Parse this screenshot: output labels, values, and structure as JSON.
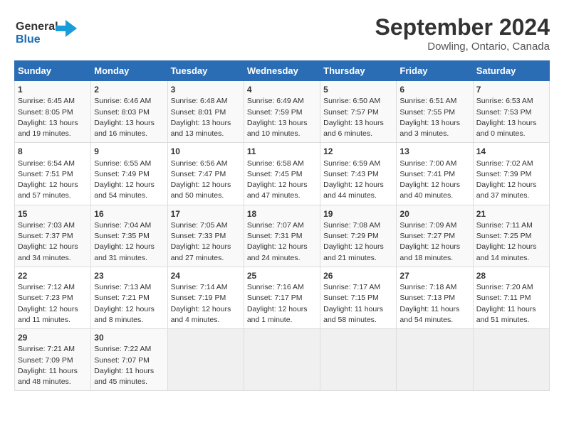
{
  "header": {
    "logo_line1": "General",
    "logo_line2": "Blue",
    "month": "September 2024",
    "location": "Dowling, Ontario, Canada"
  },
  "days_of_week": [
    "Sunday",
    "Monday",
    "Tuesday",
    "Wednesday",
    "Thursday",
    "Friday",
    "Saturday"
  ],
  "weeks": [
    [
      {
        "day": "1",
        "info": "Sunrise: 6:45 AM\nSunset: 8:05 PM\nDaylight: 13 hours\nand 19 minutes."
      },
      {
        "day": "2",
        "info": "Sunrise: 6:46 AM\nSunset: 8:03 PM\nDaylight: 13 hours\nand 16 minutes."
      },
      {
        "day": "3",
        "info": "Sunrise: 6:48 AM\nSunset: 8:01 PM\nDaylight: 13 hours\nand 13 minutes."
      },
      {
        "day": "4",
        "info": "Sunrise: 6:49 AM\nSunset: 7:59 PM\nDaylight: 13 hours\nand 10 minutes."
      },
      {
        "day": "5",
        "info": "Sunrise: 6:50 AM\nSunset: 7:57 PM\nDaylight: 13 hours\nand 6 minutes."
      },
      {
        "day": "6",
        "info": "Sunrise: 6:51 AM\nSunset: 7:55 PM\nDaylight: 13 hours\nand 3 minutes."
      },
      {
        "day": "7",
        "info": "Sunrise: 6:53 AM\nSunset: 7:53 PM\nDaylight: 13 hours\nand 0 minutes."
      }
    ],
    [
      {
        "day": "8",
        "info": "Sunrise: 6:54 AM\nSunset: 7:51 PM\nDaylight: 12 hours\nand 57 minutes."
      },
      {
        "day": "9",
        "info": "Sunrise: 6:55 AM\nSunset: 7:49 PM\nDaylight: 12 hours\nand 54 minutes."
      },
      {
        "day": "10",
        "info": "Sunrise: 6:56 AM\nSunset: 7:47 PM\nDaylight: 12 hours\nand 50 minutes."
      },
      {
        "day": "11",
        "info": "Sunrise: 6:58 AM\nSunset: 7:45 PM\nDaylight: 12 hours\nand 47 minutes."
      },
      {
        "day": "12",
        "info": "Sunrise: 6:59 AM\nSunset: 7:43 PM\nDaylight: 12 hours\nand 44 minutes."
      },
      {
        "day": "13",
        "info": "Sunrise: 7:00 AM\nSunset: 7:41 PM\nDaylight: 12 hours\nand 40 minutes."
      },
      {
        "day": "14",
        "info": "Sunrise: 7:02 AM\nSunset: 7:39 PM\nDaylight: 12 hours\nand 37 minutes."
      }
    ],
    [
      {
        "day": "15",
        "info": "Sunrise: 7:03 AM\nSunset: 7:37 PM\nDaylight: 12 hours\nand 34 minutes."
      },
      {
        "day": "16",
        "info": "Sunrise: 7:04 AM\nSunset: 7:35 PM\nDaylight: 12 hours\nand 31 minutes."
      },
      {
        "day": "17",
        "info": "Sunrise: 7:05 AM\nSunset: 7:33 PM\nDaylight: 12 hours\nand 27 minutes."
      },
      {
        "day": "18",
        "info": "Sunrise: 7:07 AM\nSunset: 7:31 PM\nDaylight: 12 hours\nand 24 minutes."
      },
      {
        "day": "19",
        "info": "Sunrise: 7:08 AM\nSunset: 7:29 PM\nDaylight: 12 hours\nand 21 minutes."
      },
      {
        "day": "20",
        "info": "Sunrise: 7:09 AM\nSunset: 7:27 PM\nDaylight: 12 hours\nand 18 minutes."
      },
      {
        "day": "21",
        "info": "Sunrise: 7:11 AM\nSunset: 7:25 PM\nDaylight: 12 hours\nand 14 minutes."
      }
    ],
    [
      {
        "day": "22",
        "info": "Sunrise: 7:12 AM\nSunset: 7:23 PM\nDaylight: 12 hours\nand 11 minutes."
      },
      {
        "day": "23",
        "info": "Sunrise: 7:13 AM\nSunset: 7:21 PM\nDaylight: 12 hours\nand 8 minutes."
      },
      {
        "day": "24",
        "info": "Sunrise: 7:14 AM\nSunset: 7:19 PM\nDaylight: 12 hours\nand 4 minutes."
      },
      {
        "day": "25",
        "info": "Sunrise: 7:16 AM\nSunset: 7:17 PM\nDaylight: 12 hours\nand 1 minute."
      },
      {
        "day": "26",
        "info": "Sunrise: 7:17 AM\nSunset: 7:15 PM\nDaylight: 11 hours\nand 58 minutes."
      },
      {
        "day": "27",
        "info": "Sunrise: 7:18 AM\nSunset: 7:13 PM\nDaylight: 11 hours\nand 54 minutes."
      },
      {
        "day": "28",
        "info": "Sunrise: 7:20 AM\nSunset: 7:11 PM\nDaylight: 11 hours\nand 51 minutes."
      }
    ],
    [
      {
        "day": "29",
        "info": "Sunrise: 7:21 AM\nSunset: 7:09 PM\nDaylight: 11 hours\nand 48 minutes."
      },
      {
        "day": "30",
        "info": "Sunrise: 7:22 AM\nSunset: 7:07 PM\nDaylight: 11 hours\nand 45 minutes."
      },
      {
        "day": "",
        "info": ""
      },
      {
        "day": "",
        "info": ""
      },
      {
        "day": "",
        "info": ""
      },
      {
        "day": "",
        "info": ""
      },
      {
        "day": "",
        "info": ""
      }
    ]
  ]
}
